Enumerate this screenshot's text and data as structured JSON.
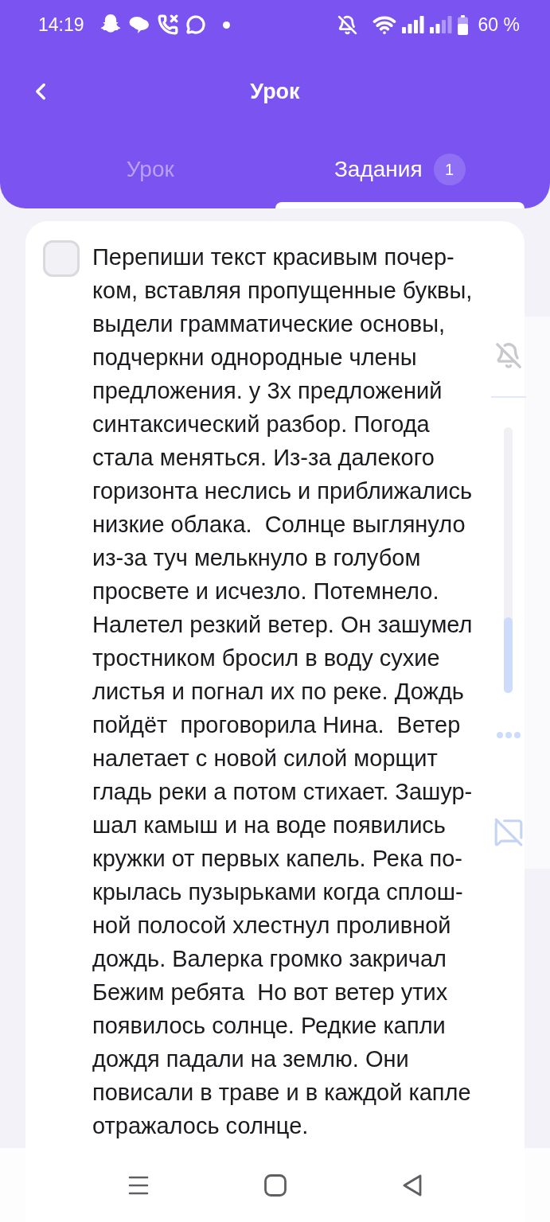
{
  "status_bar": {
    "time": "14:19",
    "battery": "60 %"
  },
  "header": {
    "title": "Урок"
  },
  "tabs": [
    {
      "label": "Урок",
      "selected": false
    },
    {
      "label": "Задания",
      "selected": true,
      "badge": "1"
    }
  ],
  "task": {
    "checked": false,
    "text": "Перепиши текст красивым почер-\nком, вставляя пропущенные буквы,\nвыдели грамматические основы,\nподчеркни однородные члены\nпредложения. у 3х предложений\nсинтаксический разбор. Погода\nстала меняться. Из-за далекого\nгоризонта неслись и приближались\nнизкие облака.  Солнце выглянуло\nиз-за туч мелькнуло в голубом\nпросвете и исчезло. Потемнело.\nНалетел резкий ветер. Он зашумел\nтростником бросил в воду сухие\nлистья и погнал их по реке. Дождь\nпойдёт  проговорила Нина.  Ветер\nналетает с новой силой морщит\nгладь реки а потом стихает. Зашур-\nшал камыш и на воде появились\nкружки от первых капель. Река по-\nкрылась пузырьками когда сплош-\nной полосой хлестнул проливной\nдождь. Валерка громко закричал\nБежим ребята  Но вот ветер утих\nпоявилось солнце. Редкие капли\nдождя падали на землю. Они\nповисали в траве и в каждой капле\nотражалось солнце."
  }
}
